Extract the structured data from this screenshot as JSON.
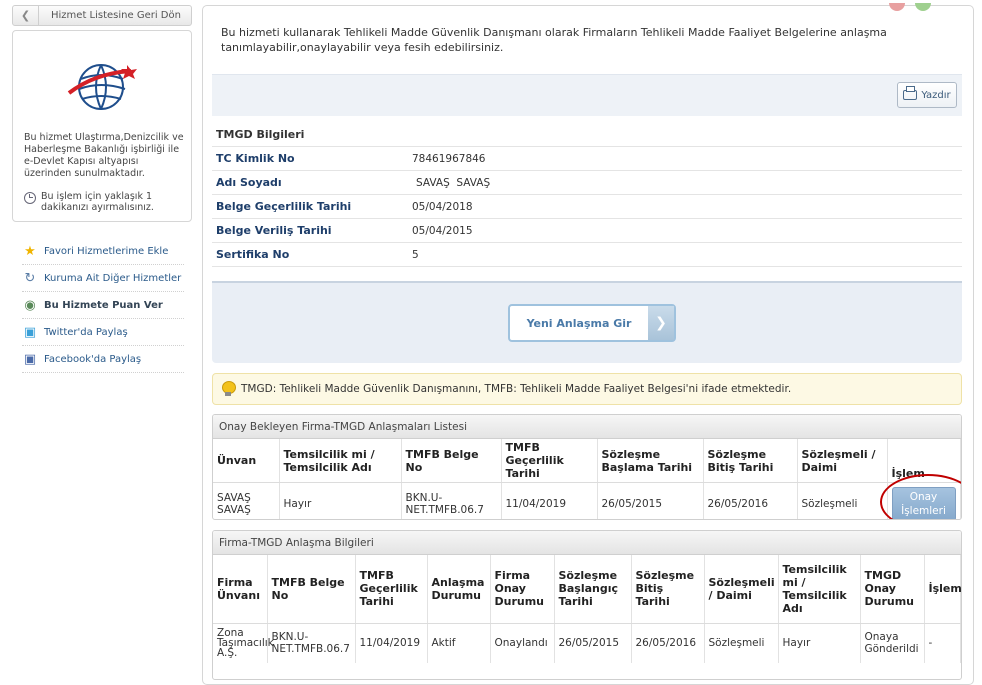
{
  "sidebar": {
    "back_label": "Hizmet Listesine Geri Dön",
    "info_text": "Bu hizmet Ulaştırma,Denizcilik ve Haberleşme Bakanlığı işbirliği ile e-Devlet Kapısı altyapısı üzerinden sunulmaktadır.",
    "duration_text": "Bu işlem için yaklaşık 1 dakikanızı ayırmalısınız.",
    "links": [
      {
        "label": "Favori Hizmetlerime Ekle",
        "icon": "star-icon"
      },
      {
        "label": "Kuruma Ait Diğer Hizmetler",
        "icon": "arrow-icon"
      },
      {
        "label": "Bu Hizmete Puan Ver",
        "icon": "rating-icon"
      },
      {
        "label": "Twitter'da Paylaş",
        "icon": "twitter-icon"
      },
      {
        "label": "Facebook'da Paylaş",
        "icon": "facebook-icon"
      }
    ]
  },
  "main": {
    "intro": "Bu hizmeti kullanarak Tehlikeli Madde Güvenlik Danışmanı olarak Firmaların Tehlikeli Madde Faaliyet Belgelerine anlaşma tanımlayabilir,onaylayabilir veya fesih edebilirsiniz.",
    "print_label": "Yazdır",
    "tmgd": {
      "heading": "TMGD Bilgileri",
      "rows": [
        {
          "label": "TC Kimlik No",
          "value": "78461967846"
        },
        {
          "label": "Adı Soyadı",
          "value": "SAVAŞ  SAVAŞ"
        },
        {
          "label": "Belge Geçerlilik Tarihi",
          "value": "05/04/2018"
        },
        {
          "label": "Belge Veriliş Tarihi",
          "value": "05/04/2015"
        },
        {
          "label": "Sertifika No",
          "value": "5"
        }
      ]
    },
    "new_agreement_label": "Yeni Anlaşma Gir",
    "notice": "TMGD: Tehlikeli Madde Güvenlik Danışmanını, TMFB: Tehlikeli Madde Faaliyet Belgesi'ni ifade etmektedir.",
    "pending": {
      "title": "Onay Bekleyen Firma-TMGD Anlaşmaları Listesi",
      "headers": [
        "Ünvan",
        "Temsilcilik mi / Temsilcilik Adı",
        "TMFB Belge No",
        "TMFB Geçerlilik Tarihi",
        "Sözleşme Başlama Tarihi",
        "Sözleşme Bitiş Tarihi",
        "Sözleşmeli / Daimi",
        "İşlem"
      ],
      "row": {
        "unvan": "SAVAŞ SAVAŞ",
        "temsilcilik": "Hayır",
        "belge_no": "BKN.U-NET.TMFB.06.7",
        "gecerlilik": "11/04/2019",
        "baslama": "26/05/2015",
        "bitis": "26/05/2016",
        "tur": "Sözleşmeli",
        "action": "Onay İşlemleri"
      }
    },
    "agreements": {
      "title": "Firma-TMGD Anlaşma Bilgileri",
      "headers": [
        "Firma Ünvanı",
        "TMFB Belge No",
        "TMFB Geçerlilik Tarihi",
        "Anlaşma Durumu",
        "Firma Onay Durumu",
        "Sözleşme Başlangıç Tarihi",
        "Sözleşme Bitiş Tarihi",
        "Sözleşmeli / Daimi",
        "Temsilcilik mi / Temsilcilik Adı",
        "TMGD Onay Durumu",
        "İşlem"
      ],
      "row": {
        "firma": "Zona Taşımacılık A.Ş.",
        "belge_no": "BKN.U-NET.TMFB.06.7",
        "gecerlilik": "11/04/2019",
        "anlasma": "Aktif",
        "firma_onay": "Onaylandı",
        "baslangic": "26/05/2015",
        "bitis": "26/05/2016",
        "tur": "Sözleşmeli",
        "temsilcilik": "Hayır",
        "tmgd_onay": "Onaya Gönderildi",
        "islem": "-"
      }
    }
  }
}
